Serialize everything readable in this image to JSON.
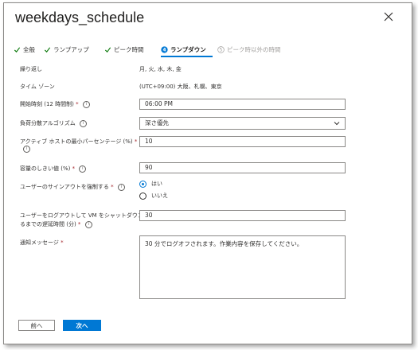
{
  "dialog": {
    "title": "weekdays_schedule"
  },
  "tabs": [
    {
      "label": "全般",
      "state": "done"
    },
    {
      "label": "ランプアップ",
      "state": "done"
    },
    {
      "label": "ピーク時間",
      "state": "done"
    },
    {
      "label": "ランプダウン",
      "state": "active",
      "number": "4"
    },
    {
      "label": "ピーク時以外の時間",
      "state": "disabled",
      "number": "5"
    }
  ],
  "fields": {
    "repeat": {
      "label": "繰り返し",
      "value": "月, 火, 水, 木, 金"
    },
    "timezone": {
      "label": "タイム ゾーン",
      "value": "(UTC+09:00) 大阪、札幌、東京"
    },
    "start_time": {
      "label": "開始時刻 (12 時間制)",
      "required": "*",
      "value": "06:00 PM"
    },
    "load_balancing": {
      "label": "負荷分散アルゴリズム",
      "value": "深さ優先"
    },
    "min_host_pct": {
      "label_line1": "アクティブ ホストの最小パーセンテージ (%)",
      "required": "*",
      "value": "10"
    },
    "capacity_threshold": {
      "label": "容量のしきい値 (%)",
      "required": "*",
      "value": "90"
    },
    "force_signout": {
      "label": "ユーザーのサインアウトを強制する",
      "required": "*",
      "options": [
        "はい",
        "いいえ"
      ],
      "selected": "はい"
    },
    "delay": {
      "label_line1": "ユーザーをログアウトして VM をシャットダウンす",
      "label_line2": "るまでの遅延時間 (分)",
      "required": "*",
      "value": "30"
    },
    "notification": {
      "label": "通知メッセージ",
      "required": "*",
      "value": "30 分でログオフされます。作業内容を保存してください。"
    }
  },
  "buttons": {
    "prev": "前へ",
    "next": "次へ"
  },
  "colors": {
    "accent": "#0078d4",
    "check": "#107c10",
    "required": "#a4262c"
  }
}
